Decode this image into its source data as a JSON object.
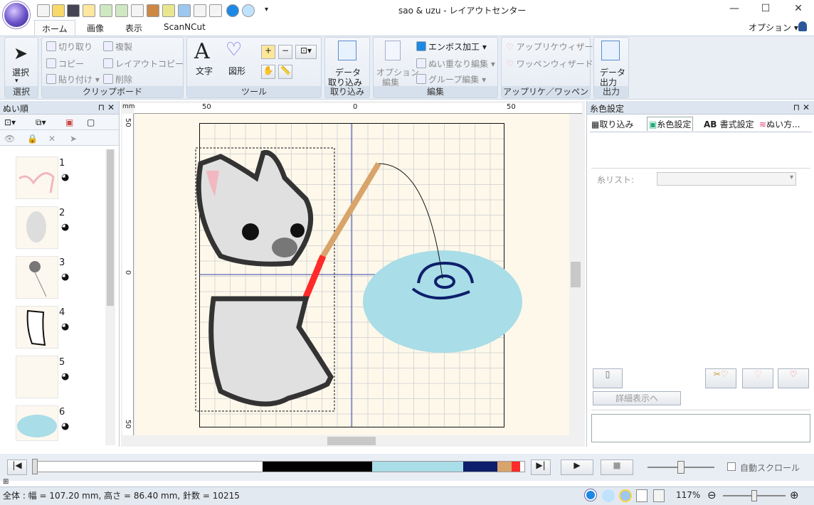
{
  "window": {
    "title": "sao & uzu - レイアウトセンター",
    "minimize": "—",
    "maximize": "☐",
    "close": "✕"
  },
  "tabs": [
    "ホーム",
    "画像",
    "表示",
    "ScanNCut"
  ],
  "options_label": "オプション",
  "ribbon": {
    "select": {
      "button": "選択",
      "group": "選択"
    },
    "clipboard": {
      "cut": "切り取り",
      "duplicate": "複製",
      "copy": "コピー",
      "layout_copy": "レイアウトコピー",
      "paste": "貼り付け",
      "delete": "削除",
      "group": "クリップボード"
    },
    "tools": {
      "text": "文字",
      "shape": "図形",
      "group": "ツール"
    },
    "import": {
      "button_line1": "データ",
      "button_line2": "取り込み",
      "group": "取り込み"
    },
    "edit": {
      "option_line1": "オプション",
      "option_line2": "編集",
      "emboss": "エンボス加工",
      "stitch_overlap": "ぬい重なり編集",
      "group_edit": "グループ編集",
      "group": "編集"
    },
    "applique": {
      "wizard": "アップリケウィザード",
      "patch_wizard": "ワッペンウィザード",
      "group": "アップリケ／ワッペン"
    },
    "output": {
      "button_line1": "データ",
      "button_line2": "出力",
      "group": "出力"
    }
  },
  "left_pane": {
    "title": "ぬい順",
    "items": [
      "1",
      "2",
      "3",
      "4",
      "5",
      "6"
    ]
  },
  "rulers": {
    "x": [
      "50",
      "0",
      "50"
    ],
    "y": [
      "50",
      "0",
      "50"
    ],
    "unit": "mm"
  },
  "right_pane": {
    "title": "糸色設定",
    "tabs": [
      "取り込み",
      "糸色設定",
      "書式設定",
      "ぬい方..."
    ],
    "thread_list_label": "糸リスト:",
    "detail_button": "詳細表示へ"
  },
  "playbar": {
    "auto_scroll": "自動スクロール"
  },
  "status": {
    "text": "全体 : 幅 = 107.20 mm, 高さ = 86.40 mm, 針数 = 10215",
    "zoom": "117%"
  },
  "colors": {
    "accent": "#2b579a",
    "thread_bar": [
      "#ffffff",
      "#000000",
      "#a9dde8",
      "#0d1f6b",
      "#d8a46b",
      "#ff2a2a"
    ]
  }
}
